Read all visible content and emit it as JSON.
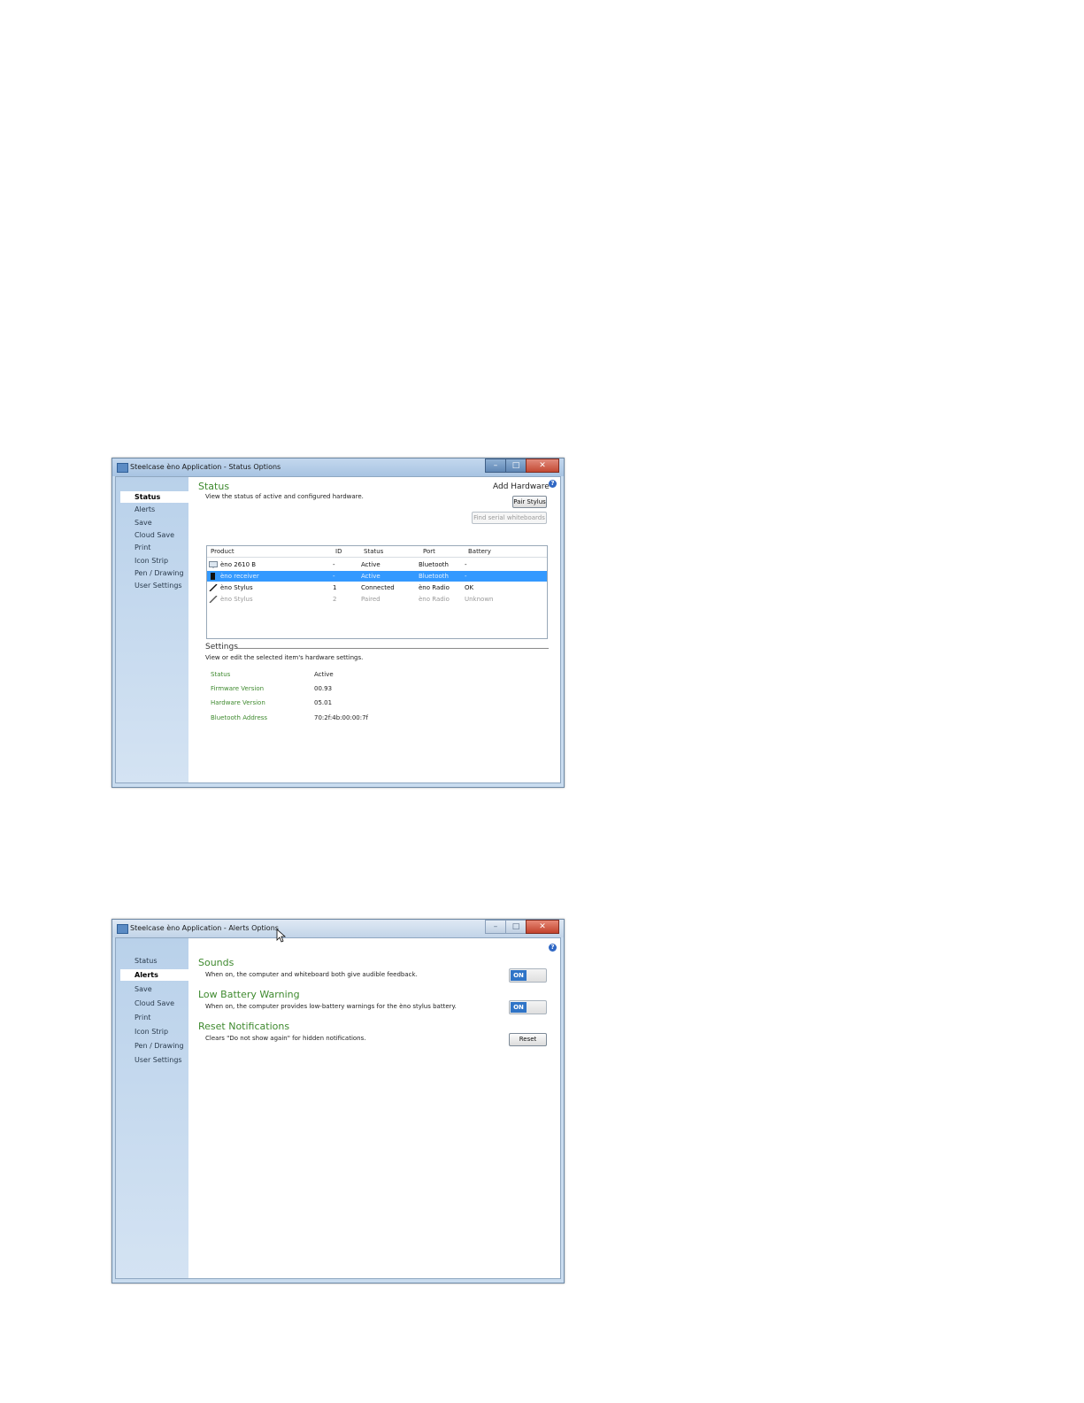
{
  "window1": {
    "title": "Steelcase èno Application - Status Options",
    "controls": {
      "minimize": "–",
      "maximize": "□",
      "close": "✕"
    },
    "sidebar": [
      "Status",
      "Alerts",
      "Save",
      "Cloud Save",
      "Print",
      "Icon Strip",
      "Pen / Drawing",
      "User Settings"
    ],
    "active_item": "Status",
    "status_title": "Status",
    "status_desc": "View the status of active and configured hardware.",
    "add_hardware": "Add Hardware",
    "help": "?",
    "pair_stylus": "Pair Stylus",
    "find_serial": "Find serial whiteboards",
    "table": {
      "headers": [
        "Product",
        "ID",
        "Status",
        "Port",
        "Battery"
      ],
      "rows": [
        {
          "product": "èno 2610 B",
          "id": "-",
          "status": "Active",
          "port": "Bluetooth",
          "battery": "-",
          "icon": "whiteboard-icon"
        },
        {
          "product": "èno receiver",
          "id": "-",
          "status": "Active",
          "port": "Bluetooth",
          "battery": "-",
          "icon": "receiver-icon",
          "selected": true
        },
        {
          "product": "èno Stylus",
          "id": "1",
          "status": "Connected",
          "port": "èno Radio",
          "battery": "OK",
          "icon": "stylus-icon"
        },
        {
          "product": "èno Stylus",
          "id": "2",
          "status": "Paired",
          "port": "èno Radio",
          "battery": "Unknown",
          "icon": "stylus-icon",
          "dim": true
        }
      ]
    },
    "settings_title": "Settings",
    "settings_desc": "View or edit the selected item's hardware settings.",
    "settings": [
      {
        "key": "Status",
        "value": "Active"
      },
      {
        "key": "Firmware Version",
        "value": "00.93"
      },
      {
        "key": "Hardware Version",
        "value": "05.01"
      },
      {
        "key": "Bluetooth Address",
        "value": "70:2f:4b:00:00:7f"
      }
    ]
  },
  "window2": {
    "title": "Steelcase èno Application - Alerts Options",
    "controls": {
      "minimize": "–",
      "maximize": "□",
      "close": "✕"
    },
    "sidebar": [
      "Status",
      "Alerts",
      "Save",
      "Cloud Save",
      "Print",
      "Icon Strip",
      "Pen / Drawing",
      "User Settings"
    ],
    "active_item": "Alerts",
    "help": "?",
    "sounds_title": "Sounds",
    "sounds_desc": "When on, the computer and whiteboard both give audible feedback.",
    "sounds_toggle": "ON",
    "battery_title": "Low Battery Warning",
    "battery_desc": "When on, the computer provides low-battery warnings for the èno stylus battery.",
    "battery_toggle": "ON",
    "reset_title": "Reset Notifications",
    "reset_desc": "Clears \"Do not show again\" for hidden notifications.",
    "reset_button": "Reset"
  },
  "colors": {
    "accent_green": "#3f8a2f",
    "selection_blue": "#3399ff",
    "toggle_on": "#2f74c7",
    "sidebar_blue": "#c9dcef"
  }
}
